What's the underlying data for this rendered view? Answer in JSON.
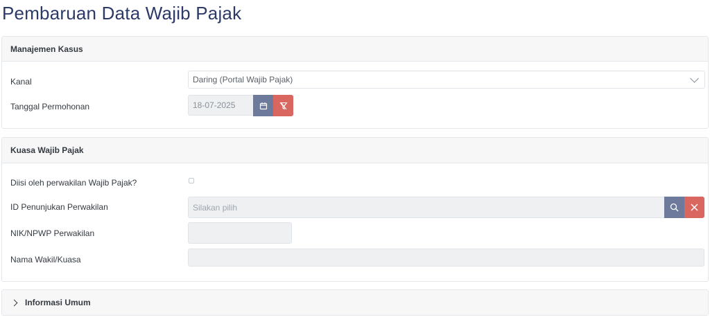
{
  "page": {
    "title": "Pembaruan Data Wajib Pajak"
  },
  "sections": {
    "case_management": {
      "title": "Manajemen Kasus",
      "channel_label": "Kanal",
      "channel_value": "Daring (Portal Wajib Pajak)",
      "request_date_label": "Tanggal Permohonan",
      "request_date_value": "18-07-2025"
    },
    "taxpayer_proxy": {
      "title": "Kuasa Wajib Pajak",
      "filled_by_rep_label": "Diisi oleh perwakilan Wajib Pajak?",
      "filled_by_rep_checked": false,
      "appointment_id_label": "ID Penunjukan Perwakilan",
      "appointment_id_placeholder": "Silakan pilih",
      "nik_npwp_label": "NIK/NPWP Perwakilan",
      "nik_npwp_value": "",
      "rep_name_label": "Nama Wakil/Kuasa",
      "rep_name_value": ""
    },
    "general_info": {
      "title": "Informasi Umum",
      "expanded": false
    }
  },
  "icons": {
    "calendar": "calendar-icon",
    "clear_filter": "filter-clear-icon",
    "search": "search-icon",
    "close": "close-icon",
    "dropdown": "chevron-down-icon",
    "expand": "chevron-right-icon"
  },
  "colors": {
    "title": "#2d3a67",
    "slate_button": "#6e7a9b",
    "red_button": "#d9675f",
    "header_bg": "#f7f7f8",
    "disabled_bg": "#eef0f2"
  }
}
